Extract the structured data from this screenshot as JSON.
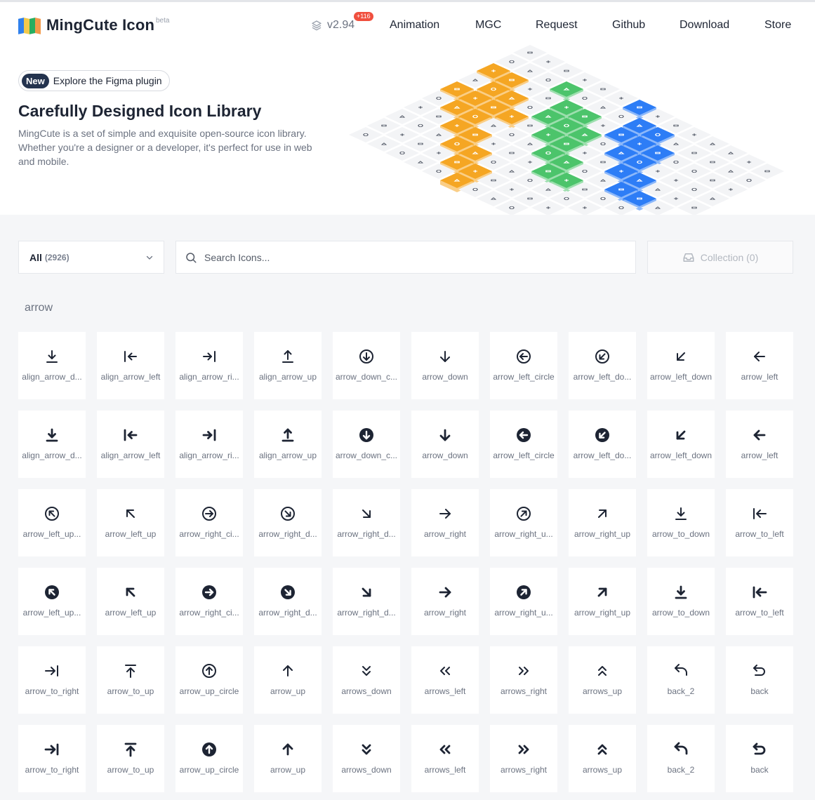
{
  "header": {
    "brand": "MingCute Icon",
    "beta": "beta",
    "version": "v2.94",
    "version_badge": "+116",
    "nav": [
      "Animation",
      "MGC",
      "Request",
      "Github",
      "Download",
      "Store"
    ],
    "logo_colors": [
      "#2f80ed",
      "#f2c94c",
      "#27ae60",
      "#f2994a"
    ]
  },
  "hero": {
    "pill_tag": "New",
    "pill_text": "Explore the Figma plugin",
    "title": "Carefully Designed Icon Library",
    "description": "MingCute is a set of simple and exquisite open-source icon library. Whether you're a designer or a developer, it's perfect for use in web and mobile.",
    "mosaic_colors": {
      "orange": "#f5a623",
      "green": "#4cc46b",
      "blue": "#2d7df6"
    }
  },
  "controls": {
    "category_label": "All",
    "category_count": "(2926)",
    "search_placeholder": "Search Icons...",
    "collection_label": "Collection (0)"
  },
  "section_title": "arrow",
  "icons": [
    {
      "name": "align_arrow_d...",
      "icon": "align-arrow-down-icon",
      "g": "alignDown",
      "f": false
    },
    {
      "name": "align_arrow_left",
      "icon": "align-arrow-left-icon",
      "g": "alignLeft",
      "f": false
    },
    {
      "name": "align_arrow_ri...",
      "icon": "align-arrow-right-icon",
      "g": "alignRight",
      "f": false
    },
    {
      "name": "align_arrow_up",
      "icon": "align-arrow-up-icon",
      "g": "alignUp",
      "f": false
    },
    {
      "name": "arrow_down_c...",
      "icon": "arrow-down-circle-icon",
      "g": "downC",
      "f": false
    },
    {
      "name": "arrow_down",
      "icon": "arrow-down-icon",
      "g": "down",
      "f": false
    },
    {
      "name": "arrow_left_circle",
      "icon": "arrow-left-circle-icon",
      "g": "leftC",
      "f": false
    },
    {
      "name": "arrow_left_do...",
      "icon": "arrow-left-down-circle-icon",
      "g": "leftDownC",
      "f": false
    },
    {
      "name": "arrow_left_down",
      "icon": "arrow-left-down-icon",
      "g": "leftDown",
      "f": false
    },
    {
      "name": "arrow_left",
      "icon": "arrow-left-icon",
      "g": "left",
      "f": false
    },
    {
      "name": "align_arrow_d...",
      "icon": "align-arrow-down-icon",
      "g": "alignDown",
      "f": true
    },
    {
      "name": "align_arrow_left",
      "icon": "align-arrow-left-icon",
      "g": "alignLeft",
      "f": true
    },
    {
      "name": "align_arrow_ri...",
      "icon": "align-arrow-right-icon",
      "g": "alignRight",
      "f": true
    },
    {
      "name": "align_arrow_up",
      "icon": "align-arrow-up-icon",
      "g": "alignUp",
      "f": true
    },
    {
      "name": "arrow_down_c...",
      "icon": "arrow-down-circle-icon",
      "g": "downC",
      "f": true
    },
    {
      "name": "arrow_down",
      "icon": "arrow-down-icon",
      "g": "down",
      "f": true
    },
    {
      "name": "arrow_left_circle",
      "icon": "arrow-left-circle-icon",
      "g": "leftC",
      "f": true
    },
    {
      "name": "arrow_left_do...",
      "icon": "arrow-left-down-circle-icon",
      "g": "leftDownC",
      "f": true
    },
    {
      "name": "arrow_left_down",
      "icon": "arrow-left-down-icon",
      "g": "leftDown",
      "f": true
    },
    {
      "name": "arrow_left",
      "icon": "arrow-left-icon",
      "g": "left",
      "f": true
    },
    {
      "name": "arrow_left_up...",
      "icon": "arrow-left-up-circle-icon",
      "g": "leftUpC",
      "f": false
    },
    {
      "name": "arrow_left_up",
      "icon": "arrow-left-up-icon",
      "g": "leftUp",
      "f": false
    },
    {
      "name": "arrow_right_ci...",
      "icon": "arrow-right-circle-icon",
      "g": "rightC",
      "f": false
    },
    {
      "name": "arrow_right_d...",
      "icon": "arrow-right-down-circle-icon",
      "g": "rightDownC",
      "f": false
    },
    {
      "name": "arrow_right_d...",
      "icon": "arrow-right-down-icon",
      "g": "rightDown",
      "f": false
    },
    {
      "name": "arrow_right",
      "icon": "arrow-right-icon",
      "g": "right",
      "f": false
    },
    {
      "name": "arrow_right_u...",
      "icon": "arrow-right-up-circle-icon",
      "g": "rightUpC",
      "f": false
    },
    {
      "name": "arrow_right_up",
      "icon": "arrow-right-up-icon",
      "g": "rightUp",
      "f": false
    },
    {
      "name": "arrow_to_down",
      "icon": "arrow-to-down-icon",
      "g": "toDown",
      "f": false
    },
    {
      "name": "arrow_to_left",
      "icon": "arrow-to-left-icon",
      "g": "toLeft",
      "f": false
    },
    {
      "name": "arrow_left_up...",
      "icon": "arrow-left-up-circle-icon",
      "g": "leftUpC",
      "f": true
    },
    {
      "name": "arrow_left_up",
      "icon": "arrow-left-up-icon",
      "g": "leftUp",
      "f": true
    },
    {
      "name": "arrow_right_ci...",
      "icon": "arrow-right-circle-icon",
      "g": "rightC",
      "f": true
    },
    {
      "name": "arrow_right_d...",
      "icon": "arrow-right-down-circle-icon",
      "g": "rightDownC",
      "f": true
    },
    {
      "name": "arrow_right_d...",
      "icon": "arrow-right-down-icon",
      "g": "rightDown",
      "f": true
    },
    {
      "name": "arrow_right",
      "icon": "arrow-right-icon",
      "g": "right",
      "f": true
    },
    {
      "name": "arrow_right_u...",
      "icon": "arrow-right-up-circle-icon",
      "g": "rightUpC",
      "f": true
    },
    {
      "name": "arrow_right_up",
      "icon": "arrow-right-up-icon",
      "g": "rightUp",
      "f": true
    },
    {
      "name": "arrow_to_down",
      "icon": "arrow-to-down-icon",
      "g": "toDown",
      "f": true
    },
    {
      "name": "arrow_to_left",
      "icon": "arrow-to-left-icon",
      "g": "toLeft",
      "f": true
    },
    {
      "name": "arrow_to_right",
      "icon": "arrow-to-right-icon",
      "g": "toRight",
      "f": false
    },
    {
      "name": "arrow_to_up",
      "icon": "arrow-to-up-icon",
      "g": "toUp",
      "f": false
    },
    {
      "name": "arrow_up_circle",
      "icon": "arrow-up-circle-icon",
      "g": "upC",
      "f": false
    },
    {
      "name": "arrow_up",
      "icon": "arrow-up-icon",
      "g": "up",
      "f": false
    },
    {
      "name": "arrows_down",
      "icon": "arrows-down-icon",
      "g": "dblDown",
      "f": false
    },
    {
      "name": "arrows_left",
      "icon": "arrows-left-icon",
      "g": "dblLeft",
      "f": false
    },
    {
      "name": "arrows_right",
      "icon": "arrows-right-icon",
      "g": "dblRight",
      "f": false
    },
    {
      "name": "arrows_up",
      "icon": "arrows-up-icon",
      "g": "dblUp",
      "f": false
    },
    {
      "name": "back_2",
      "icon": "back-2-icon",
      "g": "back2",
      "f": false
    },
    {
      "name": "back",
      "icon": "back-icon",
      "g": "back",
      "f": false
    },
    {
      "name": "arrow_to_right",
      "icon": "arrow-to-right-icon",
      "g": "toRight",
      "f": true
    },
    {
      "name": "arrow_to_up",
      "icon": "arrow-to-up-icon",
      "g": "toUp",
      "f": true
    },
    {
      "name": "arrow_up_circle",
      "icon": "arrow-up-circle-icon",
      "g": "upC",
      "f": true
    },
    {
      "name": "arrow_up",
      "icon": "arrow-up-icon",
      "g": "up",
      "f": true
    },
    {
      "name": "arrows_down",
      "icon": "arrows-down-icon",
      "g": "dblDown",
      "f": true
    },
    {
      "name": "arrows_left",
      "icon": "arrows-left-icon",
      "g": "dblLeft",
      "f": true
    },
    {
      "name": "arrows_right",
      "icon": "arrows-right-icon",
      "g": "dblRight",
      "f": true
    },
    {
      "name": "arrows_up",
      "icon": "arrows-up-icon",
      "g": "dblUp",
      "f": true
    },
    {
      "name": "back_2",
      "icon": "back-2-icon",
      "g": "back2",
      "f": true
    },
    {
      "name": "back",
      "icon": "back-icon",
      "g": "back",
      "f": true
    }
  ]
}
